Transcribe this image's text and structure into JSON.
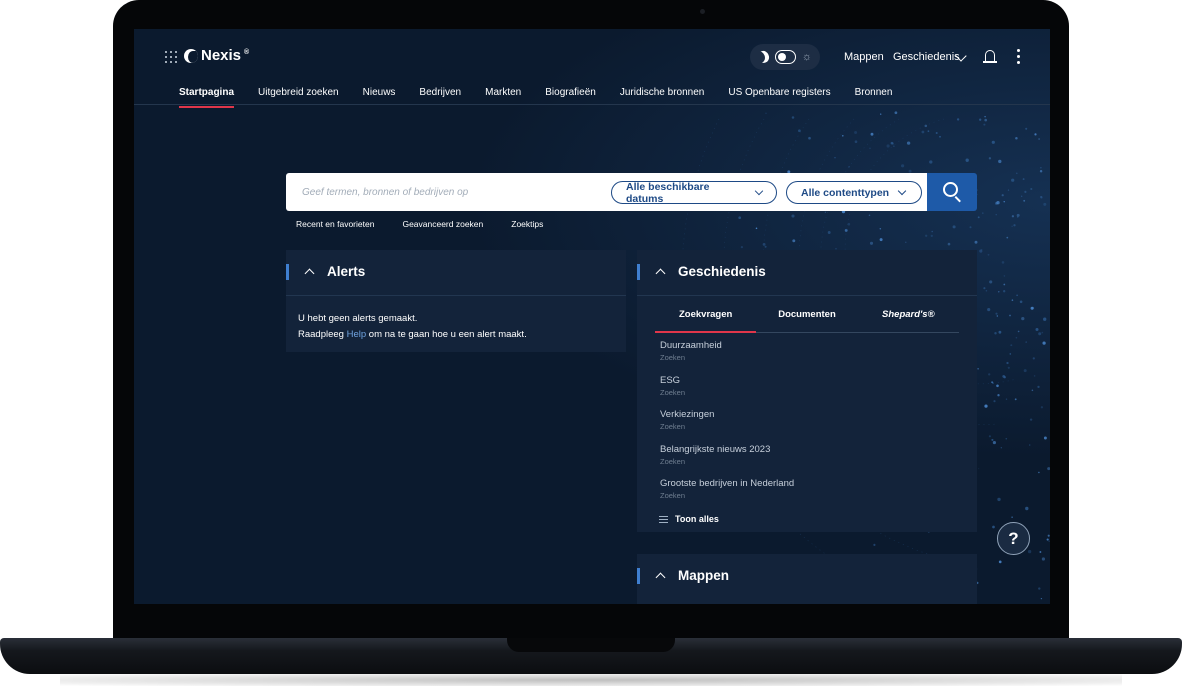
{
  "brand": {
    "name": "Nexis",
    "registered": "®"
  },
  "header": {
    "links": {
      "folders": "Mappen",
      "history": "Geschiedenis"
    },
    "icons": [
      "apps-grid-icon",
      "moon-icon",
      "sun-icon",
      "chevron-down-icon",
      "bell-icon",
      "more-vertical-icon"
    ]
  },
  "nav": {
    "items": [
      {
        "label": "Startpagina",
        "active": true
      },
      {
        "label": "Uitgebreid zoeken"
      },
      {
        "label": "Nieuws"
      },
      {
        "label": "Bedrijven"
      },
      {
        "label": "Markten"
      },
      {
        "label": "Biografieën"
      },
      {
        "label": "Juridische bronnen"
      },
      {
        "label": "US Openbare registers"
      },
      {
        "label": "Bronnen"
      }
    ]
  },
  "search": {
    "placeholder": "Geef termen, bronnen of bedrijven op",
    "date_filter": "Alle beschikbare datums",
    "content_filter": "Alle contenttypen",
    "links": [
      "Recent en favorieten",
      "Geavanceerd zoeken",
      "Zoektips"
    ]
  },
  "alerts": {
    "title": "Alerts",
    "line1": "U hebt geen alerts gemaakt.",
    "line2_pre": "Raadpleeg ",
    "line2_link": "Help",
    "line2_post": " om na te gaan hoe u een alert maakt."
  },
  "history": {
    "title": "Geschiedenis",
    "tabs": [
      {
        "label": "Zoekvragen",
        "active": true
      },
      {
        "label": "Documenten"
      },
      {
        "label": "Shepard's®"
      }
    ],
    "items": [
      {
        "title": "Duurzaamheid",
        "type": "Zoeken"
      },
      {
        "title": "ESG",
        "type": "Zoeken"
      },
      {
        "title": "Verkiezingen",
        "type": "Zoeken"
      },
      {
        "title": "Belangrijkste nieuws 2023",
        "type": "Zoeken"
      },
      {
        "title": "Grootste bedrijven in Nederland",
        "type": "Zoeken"
      }
    ],
    "show_all": "Toon alles"
  },
  "folders": {
    "title": "Mappen"
  },
  "help": {
    "label": "?"
  },
  "colors": {
    "background": "#0b1a2e",
    "card": "#13233a",
    "accent": "#3f7fd0",
    "active_tab": "#e0364a",
    "search_button": "#1e5aa8"
  }
}
